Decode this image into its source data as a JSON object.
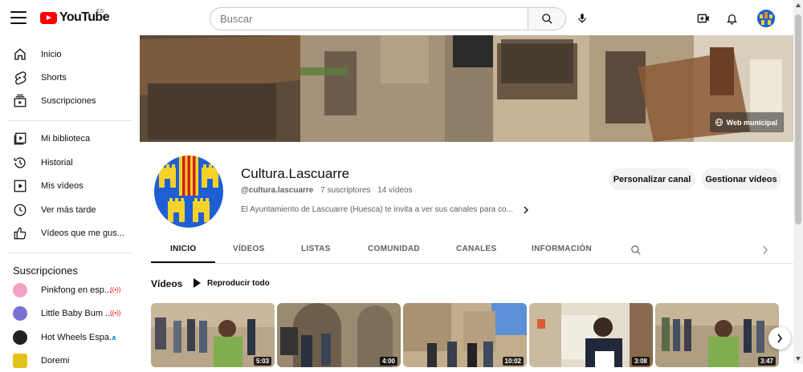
{
  "header": {
    "logo_text": "YouTube",
    "country_code": "ES",
    "search_placeholder": "Buscar"
  },
  "sidebar": {
    "main": [
      {
        "label": "Inicio",
        "icon": "home-icon"
      },
      {
        "label": "Shorts",
        "icon": "shorts-icon"
      },
      {
        "label": "Suscripciones",
        "icon": "subscriptions-icon"
      }
    ],
    "library": [
      {
        "label": "Mi biblioteca",
        "icon": "library-icon"
      },
      {
        "label": "Historial",
        "icon": "history-icon"
      },
      {
        "label": "Mis vídeos",
        "icon": "my-videos-icon"
      },
      {
        "label": "Ver más tarde",
        "icon": "watch-later-icon"
      },
      {
        "label": "Vídeos que me gus...",
        "icon": "liked-icon"
      }
    ],
    "subscriptions_title": "Suscripciones",
    "subscriptions": [
      {
        "label": "Pinkfong en esp...",
        "status": "live",
        "color": "#f4a3c6"
      },
      {
        "label": "Little Baby Bum ...",
        "status": "live",
        "color": "#7b6fd1"
      },
      {
        "label": "Hot Wheels Espa...",
        "status": "new",
        "color": "#222222"
      },
      {
        "label": "Doremi",
        "status": "",
        "color": "#e2c21a"
      }
    ]
  },
  "banner": {
    "link_label": "Web municipal"
  },
  "channel": {
    "name": "Cultura.Lascuarre",
    "handle": "@cultura.lascuarre",
    "subscribers": "7 suscriptores",
    "videos": "14 vídeos",
    "description": "El Ayuntamiento de Lascuarre (Huesca) te invita a ver sus canales para co...",
    "customize_label": "Personalizar canal",
    "manage_label": "Gestionar vídeos"
  },
  "tabs": [
    {
      "label": "INICIO",
      "active": true
    },
    {
      "label": "VÍDEOS",
      "active": false
    },
    {
      "label": "LISTAS",
      "active": false
    },
    {
      "label": "COMUNIDAD",
      "active": false
    },
    {
      "label": "CANALES",
      "active": false
    },
    {
      "label": "INFORMACIÓN",
      "active": false
    }
  ],
  "videos_section": {
    "title": "Vídeos",
    "play_all_label": "Reproducir todo",
    "items": [
      {
        "duration": "5:03"
      },
      {
        "duration": "4:00"
      },
      {
        "duration": "10:02"
      },
      {
        "duration": "3:08"
      },
      {
        "duration": "3:47"
      }
    ]
  },
  "colors": {
    "brand_red": "#ff0000",
    "text_primary": "#0f0f0f",
    "text_secondary": "#606060",
    "button_bg": "#f2f2f2"
  }
}
